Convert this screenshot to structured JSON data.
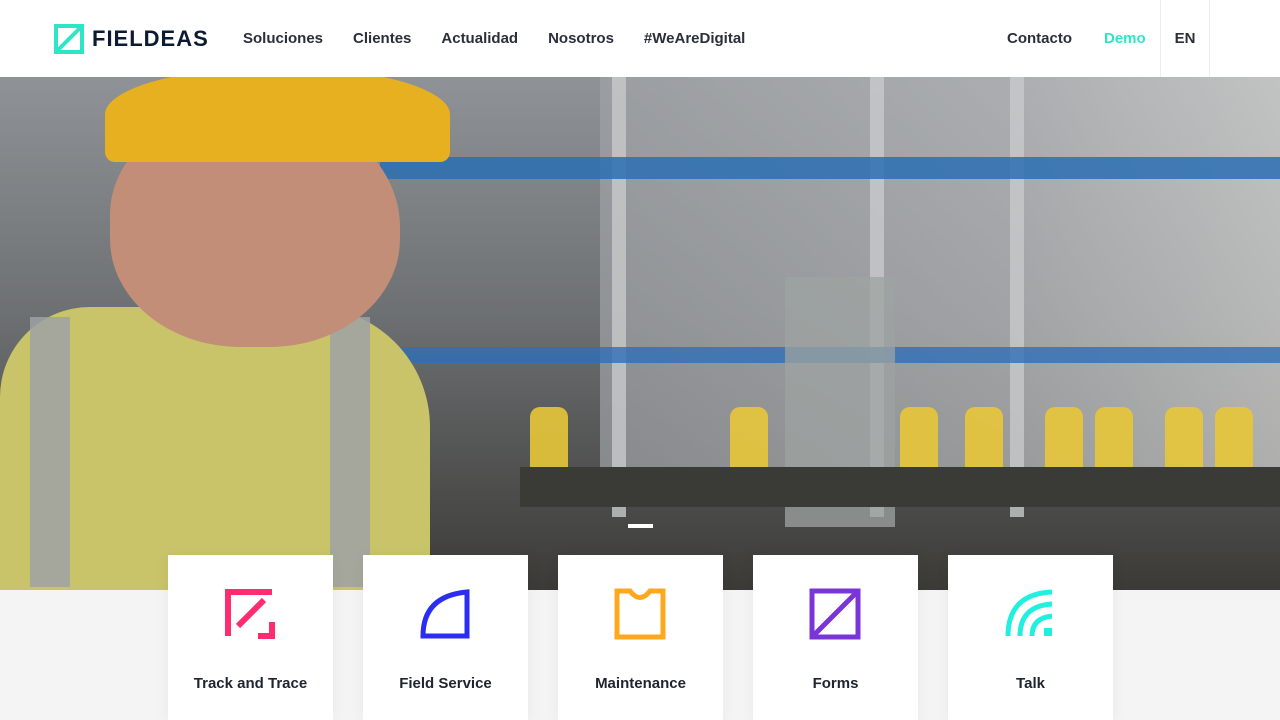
{
  "header": {
    "logo_text": "FIELDEAS",
    "nav": [
      "Soluciones",
      "Clientes",
      "Actualidad",
      "Nosotros",
      "#WeAreDigital"
    ],
    "contacto": "Contacto",
    "demo": "Demo",
    "lang": "EN"
  },
  "colors": {
    "accent": "#2ee6c6",
    "track": "#ff2d6f",
    "field": "#2b2ef0",
    "maintenance": "#ffa81e",
    "forms": "#7a35d8",
    "talk": "#1ff0e0"
  },
  "cards": [
    {
      "label": "Track and Trace",
      "icon": "track-and-trace-icon"
    },
    {
      "label": "Field Service",
      "icon": "field-service-icon"
    },
    {
      "label": "Maintenance",
      "icon": "maintenance-icon"
    },
    {
      "label": "Forms",
      "icon": "forms-icon"
    },
    {
      "label": "Talk",
      "icon": "talk-icon"
    }
  ]
}
